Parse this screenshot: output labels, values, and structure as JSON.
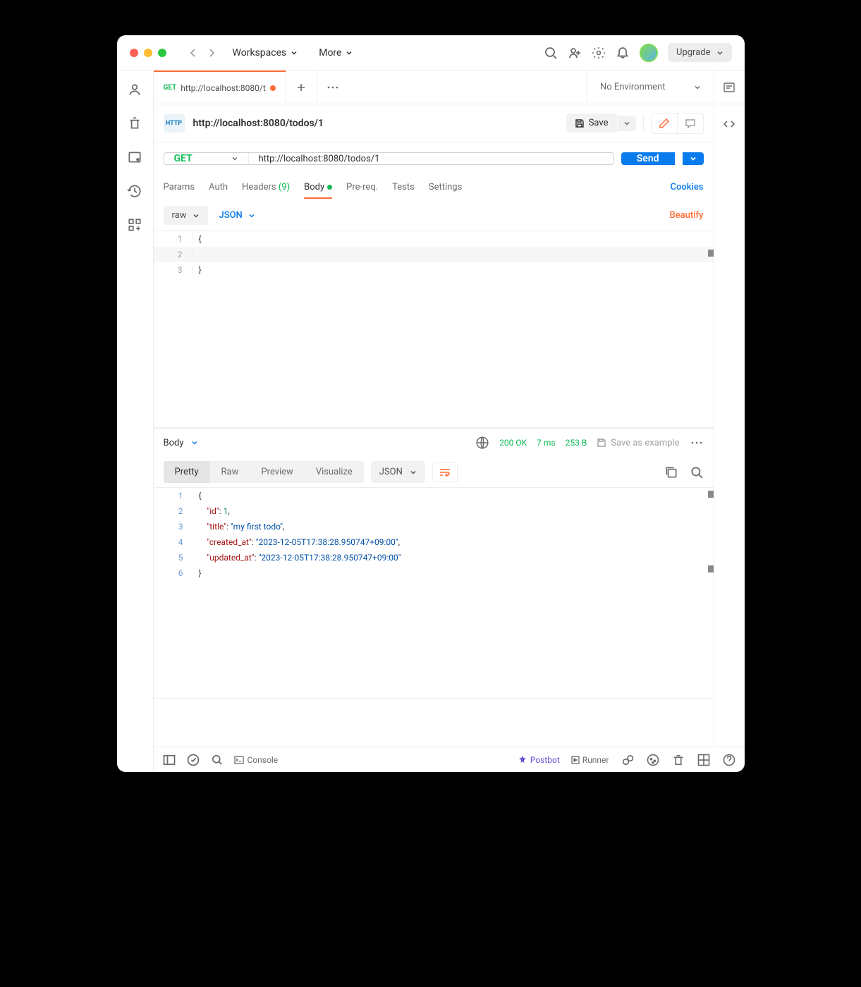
{
  "titlebar": {
    "workspaces": "Workspaces",
    "more": "More",
    "upgrade": "Upgrade"
  },
  "tab": {
    "method": "GET",
    "title": "http://localhost:8080/t"
  },
  "env": {
    "selected": "No Environment"
  },
  "request": {
    "badge": "HTTP",
    "title": "http://localhost:8080/todos/1",
    "save": "Save",
    "method": "GET",
    "url": "http://localhost:8080/todos/1",
    "send": "Send"
  },
  "reqTabs": {
    "params": "Params",
    "auth": "Auth",
    "headers": "Headers",
    "headers_count": "(9)",
    "body": "Body",
    "prereq": "Pre-req.",
    "tests": "Tests",
    "settings": "Settings",
    "cookies": "Cookies"
  },
  "bodyType": {
    "raw": "raw",
    "json": "JSON",
    "beautify": "Beautify"
  },
  "reqBody": {
    "l1": "{",
    "l2": "",
    "l3": "}"
  },
  "response": {
    "body": "Body",
    "status": "200 OK",
    "time": "7 ms",
    "size": "253 B",
    "save_example": "Save as example"
  },
  "viewTabs": {
    "pretty": "Pretty",
    "raw": "Raw",
    "preview": "Preview",
    "visualize": "Visualize",
    "json": "JSON"
  },
  "respBody": {
    "id_key": "\"id\"",
    "id_val": "1",
    "title_key": "\"title\"",
    "title_val": "\"my first todo\"",
    "created_key": "\"created_at\"",
    "created_val": "\"2023-12-05T17:38:28.950747+09:00\"",
    "updated_key": "\"updated_at\"",
    "updated_val": "\"2023-12-05T17:38:28.950747+09:00\""
  },
  "footer": {
    "console": "Console",
    "postbot": "Postbot",
    "runner": "Runner"
  }
}
